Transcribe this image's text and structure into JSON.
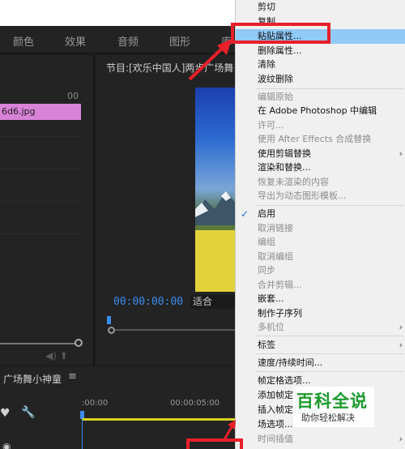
{
  "workspace_tabs": [
    "颜色",
    "效果",
    "音频",
    "图形",
    "库"
  ],
  "source_panel": {
    "ruler_label": "00",
    "clip_label": "6d6.jpg"
  },
  "program": {
    "title": "节目:[欢乐中国人]两步广场舞",
    "timecode": "00:00:00:00",
    "fit_value": "适合"
  },
  "timeline": {
    "title": "广场舞小神童",
    "menu_icon": "≡",
    "ruler_start": ":00:00",
    "ruler_next": "00:00:05:00"
  },
  "context_menu": {
    "items": [
      {
        "label": "剪切",
        "disabled": false
      },
      {
        "label": "复制",
        "disabled": false
      },
      {
        "label": "粘贴属性...",
        "disabled": false,
        "highlighted": true
      },
      {
        "label": "删除属性...",
        "disabled": false
      },
      {
        "label": "清除",
        "disabled": false
      },
      {
        "label": "波纹删除",
        "disabled": false
      },
      {
        "label": "编辑原始",
        "disabled": true
      },
      {
        "label": "在 Adobe Photoshop 中编辑",
        "disabled": false
      },
      {
        "label": "许可...",
        "disabled": true
      },
      {
        "label": "使用 After Effects 合成替换",
        "disabled": true
      },
      {
        "label": "使用剪辑替换",
        "disabled": false,
        "submenu": true
      },
      {
        "label": "渲染和替换...",
        "disabled": false
      },
      {
        "label": "恢复未渲染的内容",
        "disabled": true
      },
      {
        "label": "导出为动态图形模板...",
        "disabled": true
      },
      {
        "label": "启用",
        "disabled": false,
        "checked": true
      },
      {
        "label": "取消链接",
        "disabled": true
      },
      {
        "label": "编组",
        "disabled": true
      },
      {
        "label": "取消编组",
        "disabled": true
      },
      {
        "label": "同步",
        "disabled": true
      },
      {
        "label": "合并剪辑...",
        "disabled": true
      },
      {
        "label": "嵌套...",
        "disabled": false
      },
      {
        "label": "制作子序列",
        "disabled": false
      },
      {
        "label": "多机位",
        "disabled": true,
        "submenu": true
      },
      {
        "label": "标签",
        "disabled": false,
        "submenu": true
      },
      {
        "label": "速度/持续时间...",
        "disabled": false
      },
      {
        "label": "帧定格选项...",
        "disabled": false
      },
      {
        "label": "添加帧定格",
        "disabled": false
      },
      {
        "label": "插入帧定格分段",
        "disabled": false
      },
      {
        "label": "场选项...",
        "disabled": false
      },
      {
        "label": "时间插值",
        "disabled": true,
        "submenu": true
      }
    ]
  },
  "watermark": {
    "main": "百科全说",
    "sub": "助你轻松解决"
  },
  "colors": {
    "highlight": "#91c9f7",
    "annotation_red": "#e8202a",
    "timecode_blue": "#3b8cf0",
    "clip_pink": "#d882d8"
  }
}
